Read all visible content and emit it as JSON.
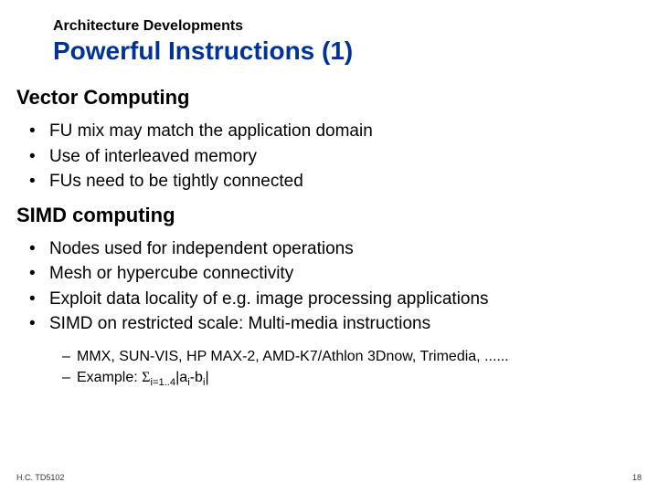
{
  "supertitle": "Architecture Developments",
  "title": "Powerful Instructions (1)",
  "sections": [
    {
      "heading": "Vector Computing",
      "bullets": [
        "FU mix may match  the application domain",
        "Use of interleaved memory",
        "FUs need to be tightly connected"
      ]
    },
    {
      "heading": "SIMD computing",
      "bullets": [
        "Nodes used for independent operations",
        "Mesh or hypercube connectivity",
        "Exploit data locality of e.g. image processing applications",
        "SIMD on restricted scale: Multi-media instructions"
      ],
      "subbullets": [
        "MMX, SUN-VIS, HP MAX-2, AMD-K7/Athlon 3Dnow, Trimedia, ......",
        "__EXAMPLE__"
      ],
      "example": {
        "prefix": "Example: ",
        "sigma": "Σ",
        "sub": "i=1..4",
        "body": "|a",
        "sub2": "i",
        "mid": "-b",
        "sub3": "i",
        "tail": "|"
      }
    }
  ],
  "footer": {
    "left": "H.C.  TD5102",
    "right": "18"
  }
}
